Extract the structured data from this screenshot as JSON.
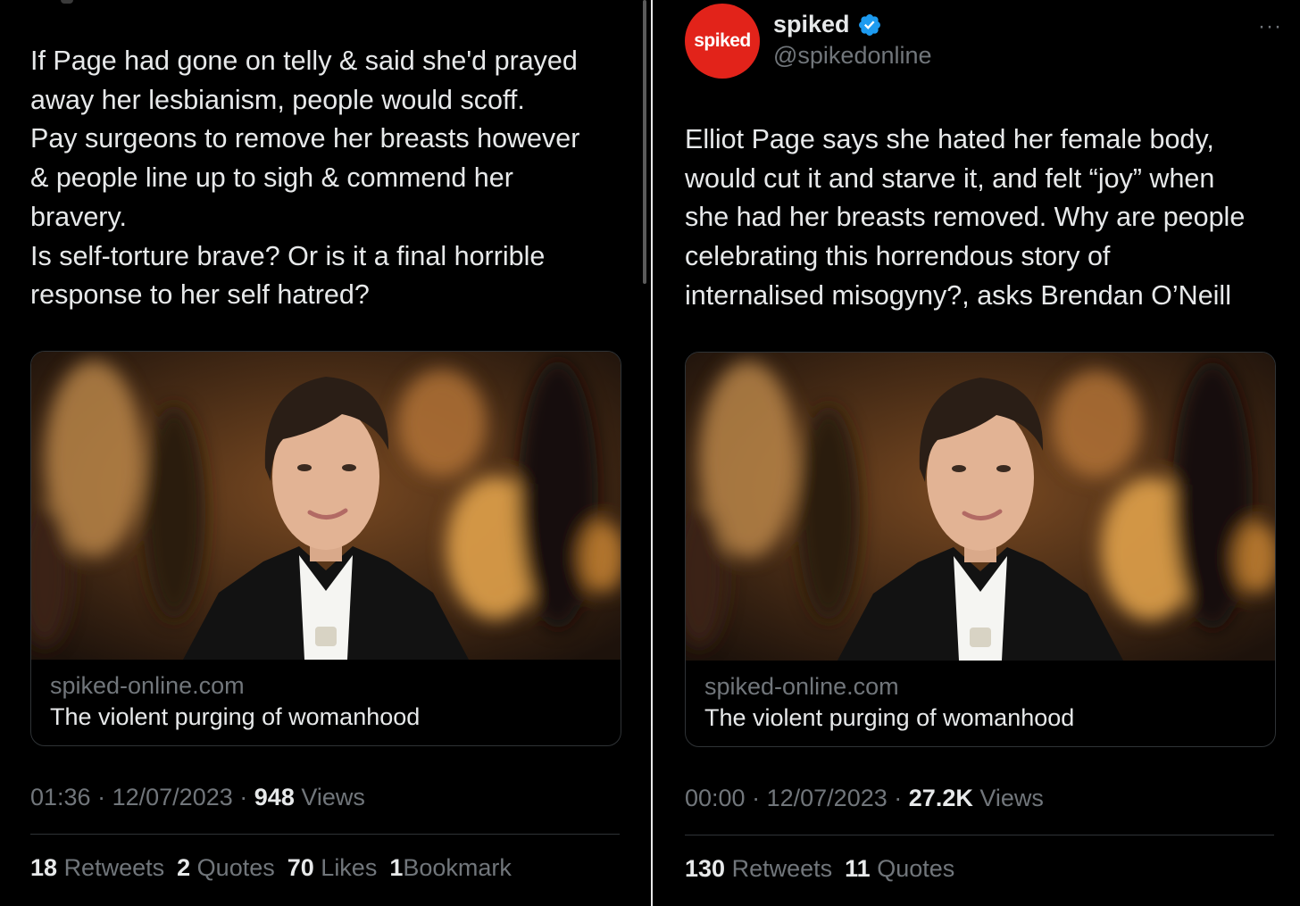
{
  "left_tweet": {
    "text": "If Page had gone on telly & said she'd prayed\naway her lesbianism, people would scoff.\nPay surgeons to remove her breasts however\n& people line up to sigh & commend her\nbravery.\nIs self-torture brave? Or is it a final horrible\nresponse to her self hatred?",
    "card": {
      "domain": "spiked-online.com",
      "title": "The violent purging of womanhood"
    },
    "time": "01:36",
    "date": "12/07/2023",
    "views_count": "948",
    "views_label": "Views",
    "stats": [
      {
        "count": "18",
        "label": "Retweets"
      },
      {
        "count": "2",
        "label": "Quotes"
      },
      {
        "count": "70",
        "label": "Likes"
      },
      {
        "count": "1",
        "label": "Bookmark"
      }
    ]
  },
  "right_tweet": {
    "avatar_text": "spiked",
    "display_name": "spiked",
    "handle": "@spikedonline",
    "text": "Elliot Page says she hated her female body,\nwould cut it and starve it, and felt “joy” when\nshe had her breasts removed. Why are people\ncelebrating this horrendous story of\ninternalised misogyny?, asks Brendan O’Neill",
    "card": {
      "domain": "spiked-online.com",
      "title": "The violent purging of womanhood"
    },
    "time": "00:00",
    "date": "12/07/2023",
    "views_count": "27.2K",
    "views_label": "Views",
    "stats": [
      {
        "count": "130",
        "label": "Retweets"
      },
      {
        "count": "11",
        "label": "Quotes"
      }
    ]
  },
  "meta_separator": "·",
  "more_icon_glyph": "···",
  "colors": {
    "background": "#000000",
    "text_primary": "#e7e9ea",
    "text_secondary": "#71767b",
    "border": "#2f3336",
    "verified_blue": "#1d9bf0",
    "avatar_red": "#e2231a"
  },
  "icons": [
    "verified-badge-icon",
    "more-options-icon"
  ]
}
